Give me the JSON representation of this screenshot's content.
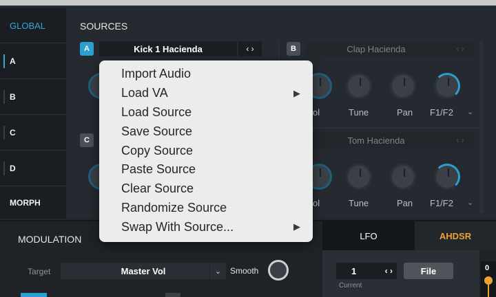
{
  "sidebar": {
    "global": "GLOBAL",
    "items": [
      {
        "label": "A",
        "active": true
      },
      {
        "label": "B",
        "active": false
      },
      {
        "label": "C",
        "active": false
      },
      {
        "label": "D",
        "active": false
      },
      {
        "label": "MORPH",
        "active": false
      }
    ]
  },
  "sources": {
    "title": "SOURCES",
    "a": {
      "letter": "A",
      "name": "Kick 1 Hacienda",
      "nav": "‹ ›"
    },
    "b": {
      "letter": "B",
      "name": "Clap Hacienda",
      "nav": "‹ ›",
      "knobs": [
        "ol",
        "Tune",
        "Pan",
        "F1/F2"
      ]
    },
    "c": {
      "letter": "C"
    },
    "d": {
      "name": "Tom Hacienda",
      "nav": "‹ ›",
      "knobs": [
        "ol",
        "Tune",
        "Pan",
        "F1/F2"
      ]
    }
  },
  "context_menu": {
    "items": [
      {
        "label": "Import Audio",
        "submenu": false
      },
      {
        "label": "Load VA",
        "submenu": true
      },
      {
        "label": "Load Source",
        "submenu": false
      },
      {
        "label": "Save Source",
        "submenu": false
      },
      {
        "label": "Copy Source",
        "submenu": false
      },
      {
        "label": "Paste Source",
        "submenu": false
      },
      {
        "label": "Clear Source",
        "submenu": false
      },
      {
        "label": "Randomize Source",
        "submenu": false
      },
      {
        "label": "Swap With Source...",
        "submenu": true
      }
    ],
    "submenu_glyph": "▶"
  },
  "modulation": {
    "title": "MODULATION",
    "target_label": "Target",
    "target_value": "Master Vol",
    "target_caret": "⌄",
    "smooth_label": "Smooth"
  },
  "lfo": {
    "tabs": [
      "LFO",
      "AHDSR"
    ],
    "active_tab": "LFO",
    "number": "1",
    "nav": "‹ ›",
    "current_label": "Current",
    "file_label": "File",
    "graph_value": "0"
  },
  "colors": {
    "accent": "#2b9fcf",
    "ahdsr": "#f0a133",
    "menu_bg": "#ececec"
  }
}
